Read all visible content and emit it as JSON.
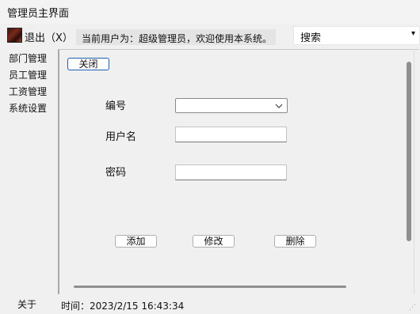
{
  "window": {
    "title": "管理员主界面"
  },
  "toolbar": {
    "logout_label": "退出（X）",
    "user_message": "当前用户为：超级管理员，欢迎使用本系统。",
    "search_label": "搜索",
    "search_arrow": "▾"
  },
  "sidebar": {
    "items": [
      {
        "label": "部门管理"
      },
      {
        "label": "员工管理"
      },
      {
        "label": "工资管理"
      },
      {
        "label": "系统设置"
      }
    ]
  },
  "form": {
    "close_label": "关闭",
    "id_label": "编号",
    "id_value": "",
    "username_label": "用户名",
    "username_value": "",
    "password_label": "密码",
    "password_value": "",
    "add_label": "添加",
    "edit_label": "修改",
    "delete_label": "删除"
  },
  "statusbar": {
    "about_label": "关于",
    "time_text": "时间：2023/2/15 16:43:34"
  },
  "colors": {
    "window_bg": "#f0f0f0",
    "focus_border": "#1a5fb4",
    "message_bg": "#e4e4e4"
  }
}
